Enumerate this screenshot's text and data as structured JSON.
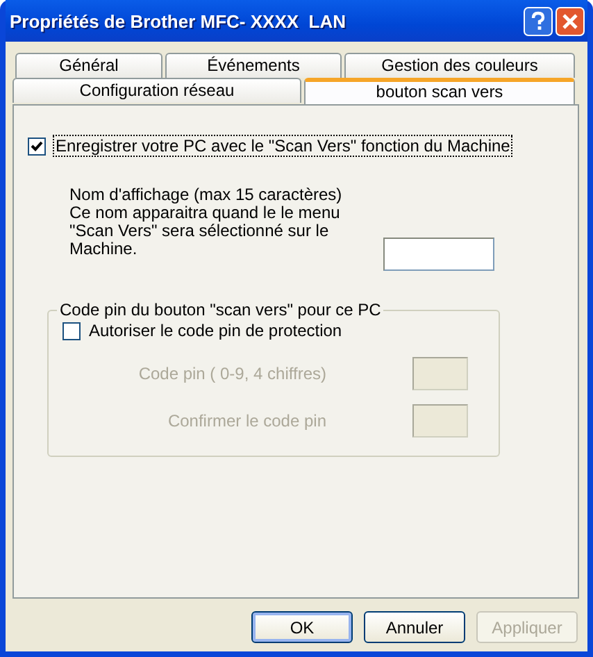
{
  "window": {
    "title": "Propriétés de Brother MFC- XXXX  LAN"
  },
  "tab_rows": [
    {
      "tabs": [
        {
          "label": "Général",
          "selected": false
        },
        {
          "label": "Événements",
          "selected": false
        },
        {
          "label": "Gestion des couleurs",
          "selected": false
        }
      ]
    },
    {
      "tabs": [
        {
          "label": "Configuration réseau",
          "selected": false
        },
        {
          "label": "bouton scan vers",
          "selected": true
        }
      ]
    }
  ],
  "register": {
    "label": "Enregistrer votre PC avec le \"Scan Vers\" fonction du Machine",
    "checked": true
  },
  "display_name": {
    "title": "Nom d'affichage (max 15 caractères)",
    "description": "Ce nom apparaitra quand le le menu \"Scan Vers\" sera sélectionné sur le Machine."
  },
  "pin_group": {
    "title": "Code pin du bouton \"scan vers\" pour ce PC",
    "protect": {
      "label": "Autoriser le code pin de protection",
      "checked": false
    },
    "fields": [
      {
        "label": "Code pin ( 0-9, 4 chiffres)",
        "disabled": true
      },
      {
        "label": "Confirmer le code pin",
        "disabled": true
      }
    ]
  },
  "buttons": [
    {
      "label": "OK",
      "default": true,
      "disabled": false
    },
    {
      "label": "Annuler",
      "default": false,
      "disabled": false
    },
    {
      "label": "Appliquer",
      "default": false,
      "disabled": true
    }
  ]
}
